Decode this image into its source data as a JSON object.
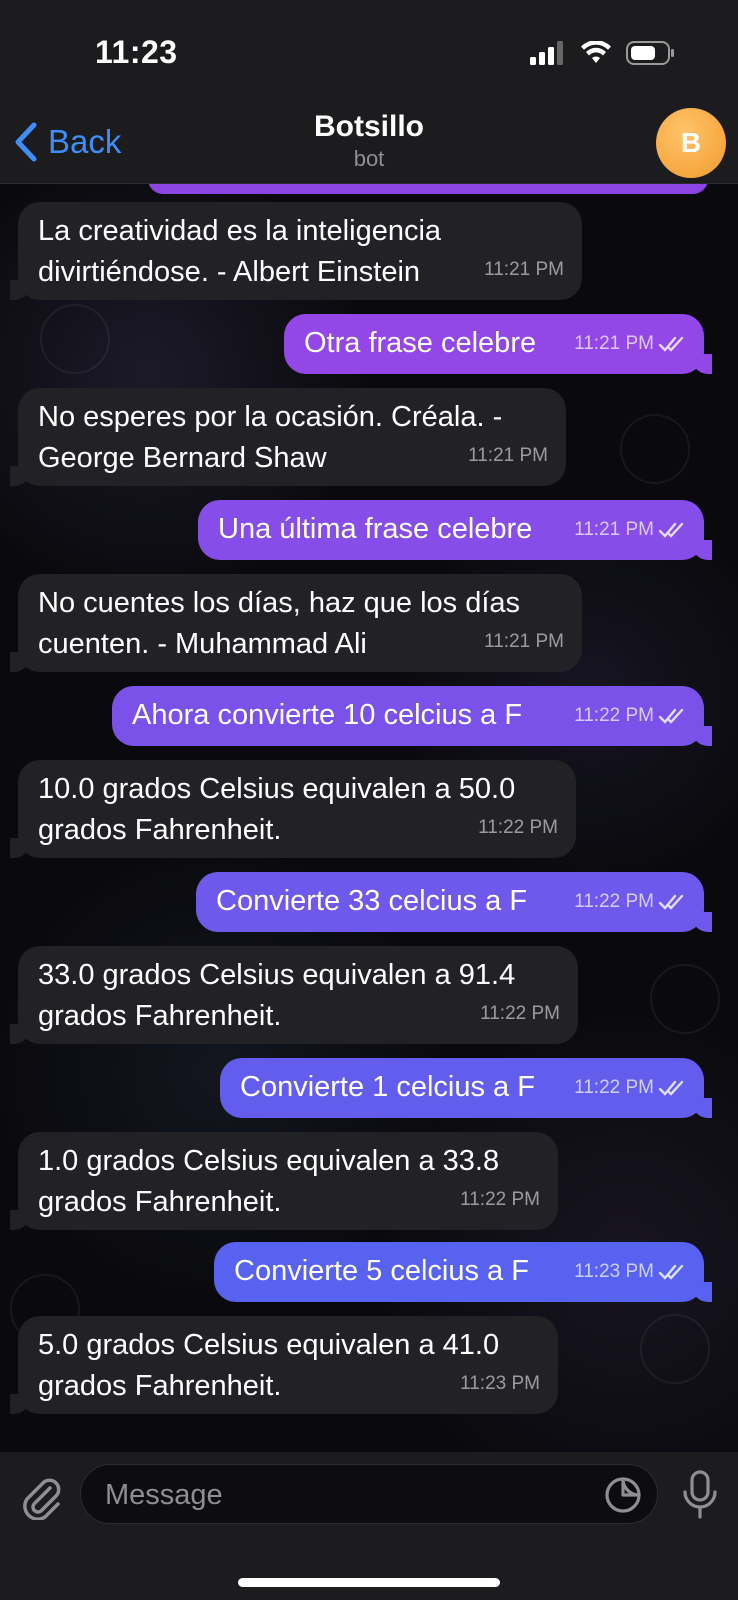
{
  "status": {
    "time": "11:23"
  },
  "header": {
    "back_label": "Back",
    "title": "Botsillo",
    "subtitle": "bot",
    "avatar_letter": "B"
  },
  "messages": [
    {
      "dir": "in",
      "lines": [
        "La creatividad es la inteligencia",
        "divirtiéndose. - Albert Einstein"
      ],
      "time": "11:21 PM"
    },
    {
      "dir": "out",
      "lines": [
        "Otra frase celebre"
      ],
      "time": "11:21 PM"
    },
    {
      "dir": "in",
      "lines": [
        "No esperes por la ocasión. Créala. -",
        "George Bernard Shaw"
      ],
      "time": "11:21 PM"
    },
    {
      "dir": "out",
      "lines": [
        "Una última frase celebre"
      ],
      "time": "11:21 PM"
    },
    {
      "dir": "in",
      "lines": [
        "No cuentes los días, haz que los días",
        "cuenten. - Muhammad Ali"
      ],
      "time": "11:21 PM"
    },
    {
      "dir": "out",
      "lines": [
        "Ahora convierte 10 celcius a F"
      ],
      "time": "11:22 PM"
    },
    {
      "dir": "in",
      "lines": [
        "10.0 grados Celsius equivalen a 50.0",
        "grados Fahrenheit."
      ],
      "time": "11:22 PM"
    },
    {
      "dir": "out",
      "lines": [
        "Convierte 33 celcius a F"
      ],
      "time": "11:22 PM"
    },
    {
      "dir": "in",
      "lines": [
        "33.0 grados Celsius equivalen a 91.4",
        "grados Fahrenheit."
      ],
      "time": "11:22 PM"
    },
    {
      "dir": "out",
      "lines": [
        "Convierte 1 celcius a F"
      ],
      "time": "11:22 PM"
    },
    {
      "dir": "in",
      "lines": [
        "1.0 grados Celsius equivalen a 33.8",
        "grados Fahrenheit."
      ],
      "time": "11:22 PM"
    },
    {
      "dir": "out",
      "lines": [
        "Convierte 5 celcius a F"
      ],
      "time": "11:23 PM"
    },
    {
      "dir": "in",
      "lines": [
        "5.0 grados Celsius equivalen a 41.0",
        "grados Fahrenheit."
      ],
      "time": "11:23 PM"
    }
  ],
  "composer": {
    "placeholder": "Message"
  },
  "colors": {
    "outgoing_top": "#9247e6",
    "outgoing_bottom": "#5763f0",
    "incoming": "#222226",
    "accent": "#3e8ef7",
    "avatar": "#f7a640"
  },
  "icons": {
    "attach": "paperclip-icon",
    "sticker": "sticker-icon",
    "mic": "microphone-icon",
    "read": "double-check-icon",
    "back": "chevron-left-icon"
  }
}
